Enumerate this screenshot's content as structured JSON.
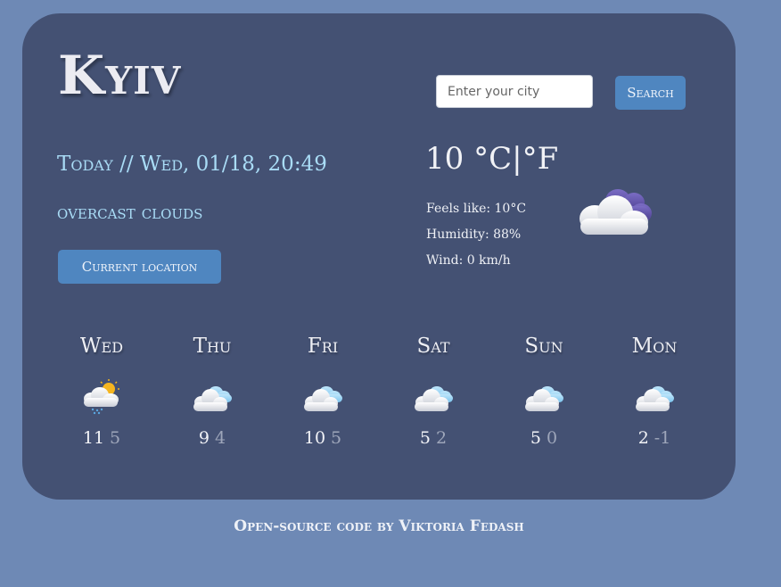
{
  "city": "Kyiv",
  "search": {
    "placeholder": "Enter your city",
    "value": "",
    "button_label": "Search"
  },
  "current": {
    "date_line": "Today // Wed, 01/18, 20:49",
    "description": "overcast clouds",
    "location_button": "Current location",
    "temperature": "10",
    "unit_c": "°C",
    "separator": "|",
    "unit_f": "°F",
    "feels_like": "Feels like: 10°C",
    "humidity": "Humidity: 88%",
    "wind": "Wind: 0 km/h",
    "icon": "overcast-clouds-night-icon"
  },
  "forecast": [
    {
      "day": "Wed",
      "max": "11",
      "min": "5",
      "icon": "sun-rain-cloud-icon"
    },
    {
      "day": "Thu",
      "max": "9",
      "min": "4",
      "icon": "cloud-icon"
    },
    {
      "day": "Fri",
      "max": "10",
      "min": "5",
      "icon": "cloud-icon"
    },
    {
      "day": "Sat",
      "max": "5",
      "min": "2",
      "icon": "cloud-icon"
    },
    {
      "day": "Sun",
      "max": "5",
      "min": "0",
      "icon": "cloud-icon"
    },
    {
      "day": "Mon",
      "max": "2",
      "min": "-1",
      "icon": "cloud-icon"
    }
  ],
  "footer": "Open-source code by Viktoria Fedash",
  "colors": {
    "page_background": "#6e89b5",
    "card_background": "#445173",
    "accent_text": "#a9dcf6",
    "button": "#4f86c0"
  }
}
